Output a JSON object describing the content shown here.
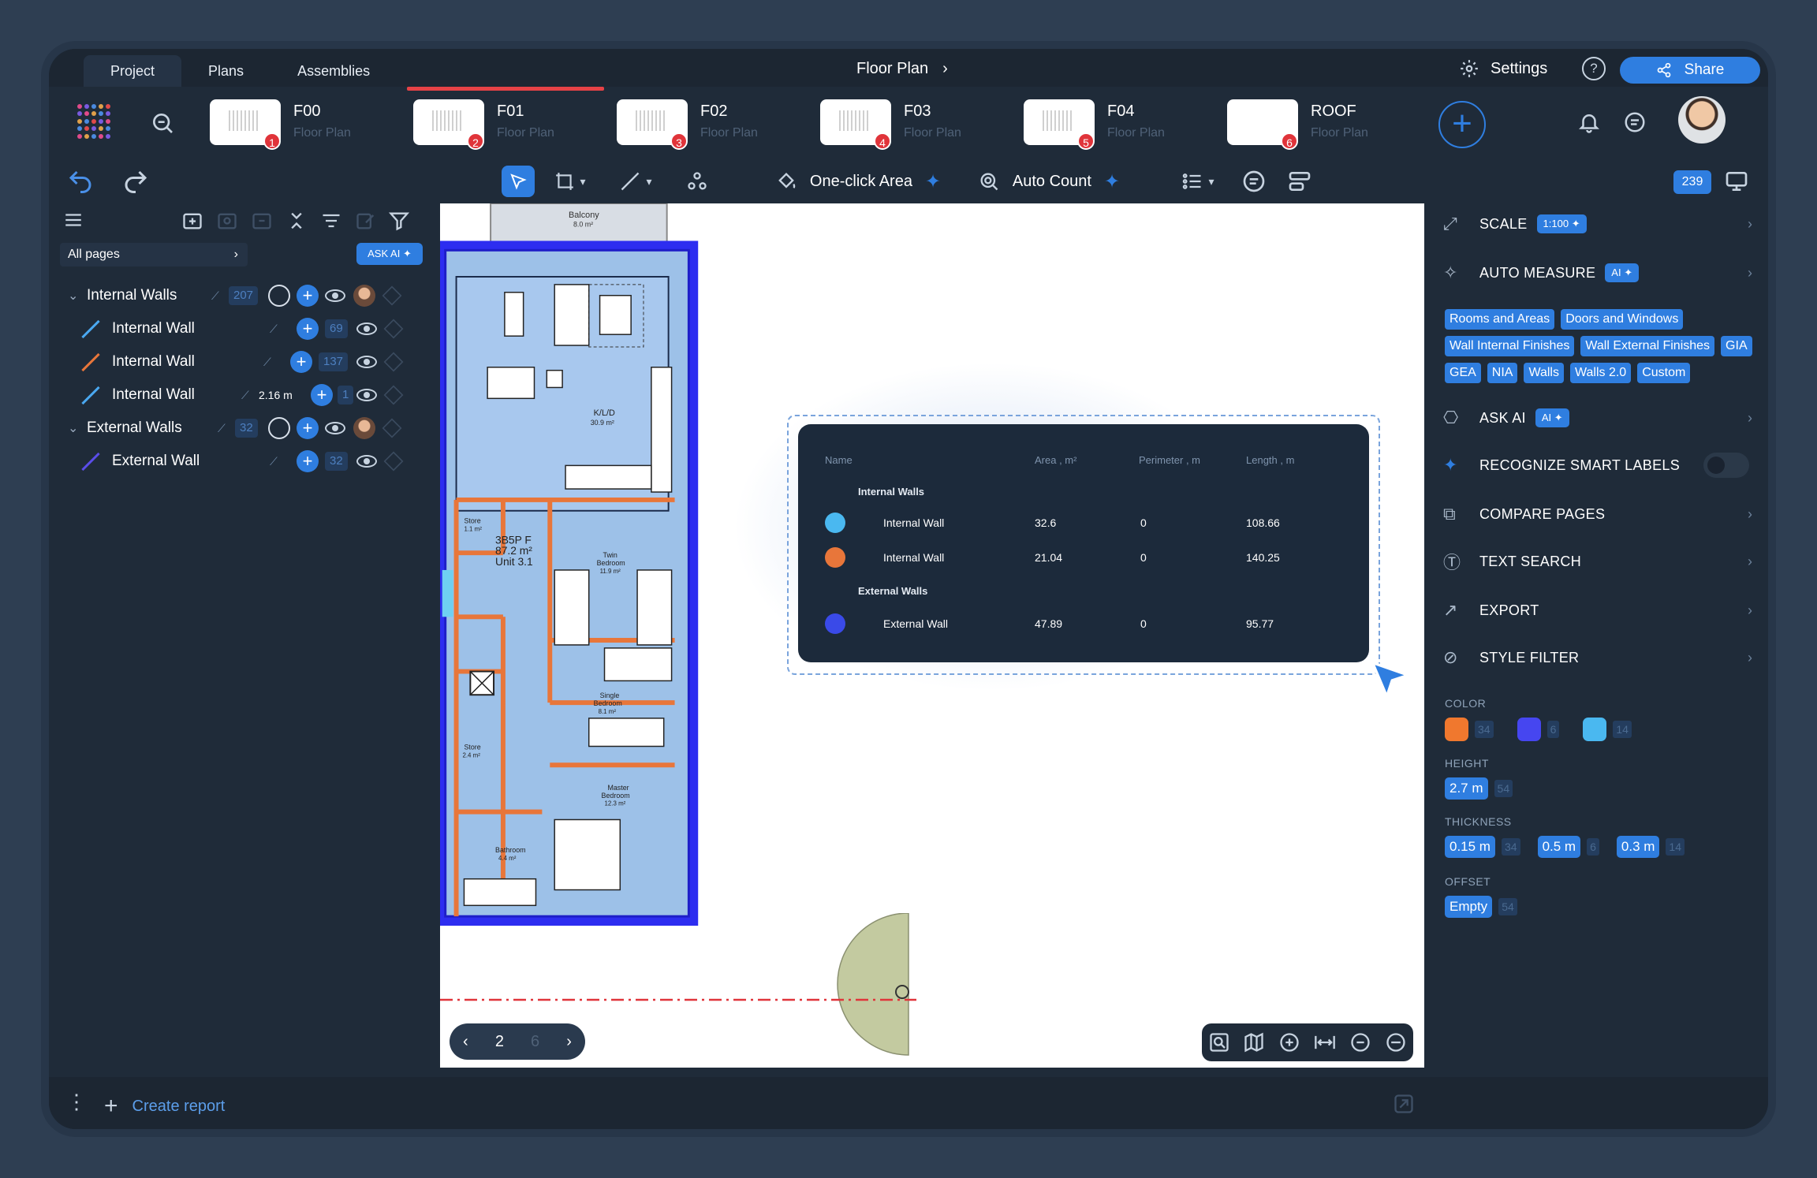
{
  "topbar": {
    "tabs": [
      "Project",
      "Plans",
      "Assemblies"
    ],
    "title": "Floor Plan",
    "settings_label": "Settings",
    "share_label": "Share"
  },
  "pages": [
    {
      "name": "F00",
      "sub": "Floor Plan",
      "badge": "1"
    },
    {
      "name": "F01",
      "sub": "Floor Plan",
      "badge": "2"
    },
    {
      "name": "F02",
      "sub": "Floor Plan",
      "badge": "3"
    },
    {
      "name": "F03",
      "sub": "Floor Plan",
      "badge": "4"
    },
    {
      "name": "F04",
      "sub": "Floor Plan",
      "badge": "5"
    },
    {
      "name": "ROOF",
      "sub": "Floor Plan",
      "badge": "6"
    }
  ],
  "toolbar": {
    "one_click_area": "One-click Area",
    "auto_count": "Auto Count",
    "count": "239"
  },
  "left": {
    "all_pages": "All pages",
    "ask_ai": "ASK AI",
    "groups": [
      {
        "label": "Internal Walls",
        "count": "207"
      },
      {
        "label": "External Walls",
        "count": "32"
      }
    ],
    "children": [
      {
        "label": "Internal Wall",
        "count": "69",
        "color": "#4aa8f0"
      },
      {
        "label": "Internal Wall",
        "count": "137",
        "color": "#e8763a"
      },
      {
        "label": "Internal Wall",
        "count": "1",
        "length": "2.16 m",
        "color": "#4aa8f0"
      },
      {
        "label": "External Wall",
        "count": "32",
        "color": "#5a4de8"
      }
    ],
    "create_report": "Create report"
  },
  "canvas": {
    "page_number": "2",
    "page_next": "6",
    "rooms": {
      "balcony": "Balcony",
      "balcony_area": "8.0 m²",
      "klid": "K/L/D",
      "klid_area": "30.9 m²",
      "store1": "Store",
      "store1_area": "1.1 m²",
      "unit": "3B5P F",
      "unit_area": "87.2 m²",
      "unit_no": "Unit 3.1",
      "twin": "Twin",
      "twin2": "Bedroom",
      "twin_area": "11.9 m²",
      "store2": "Store",
      "store2_area": "2.4 m²",
      "single": "Single",
      "single2": "Bedroom",
      "single_area": "8.1 m²",
      "master": "Master",
      "master2": "Bedroom",
      "master_area": "12.3 m²",
      "bathroom": "Bathroom",
      "bathroom_area": "4.4 m²"
    }
  },
  "popup": {
    "headers": [
      "Name",
      "Area , m²",
      "Perimeter , m",
      "Length , m"
    ],
    "group1": "Internal Walls",
    "group2": "External Walls",
    "rows": [
      {
        "name": "Internal Wall",
        "area": "32.6",
        "perimeter": "0",
        "length": "108.66",
        "color": "#4ab8f0"
      },
      {
        "name": "Internal Wall",
        "area": "21.04",
        "perimeter": "0",
        "length": "140.25",
        "color": "#e8763a"
      },
      {
        "name": "External Wall",
        "area": "47.89",
        "perimeter": "0",
        "length": "95.77",
        "color": "#3a4ae8"
      }
    ]
  },
  "right": {
    "scale": "SCALE",
    "scale_value": "1:100",
    "auto_measure": "AUTO MEASURE",
    "ai": "AI",
    "chips": [
      "Rooms and Areas",
      "Doors and Windows",
      "Wall Internal Finishes",
      "Wall External Finishes",
      "GIA",
      "GEA",
      "NIA",
      "Walls",
      "Walls 2.0",
      "Custom"
    ],
    "ask_ai": "ASK AI",
    "recognize": "RECOGNIZE SMART LABELS",
    "compare": "COMPARE PAGES",
    "text_search": "TEXT SEARCH",
    "export": "EXPORT",
    "style_filter": "STYLE FILTER",
    "color_label": "COLOR",
    "colors": [
      {
        "hex": "#f0782e",
        "n": "34"
      },
      {
        "hex": "#4646f0",
        "n": "6"
      },
      {
        "hex": "#4ab8f0",
        "n": "14"
      }
    ],
    "height_label": "HEIGHT",
    "height": {
      "v": "2.7 m",
      "n": "54"
    },
    "thickness_label": "THICKNESS",
    "thickness": [
      {
        "v": "0.15 m",
        "n": "34"
      },
      {
        "v": "0.5 m",
        "n": "6"
      },
      {
        "v": "0.3 m",
        "n": "14"
      }
    ],
    "offset_label": "OFFSET",
    "offset": {
      "v": "Empty",
      "n": "54"
    }
  }
}
